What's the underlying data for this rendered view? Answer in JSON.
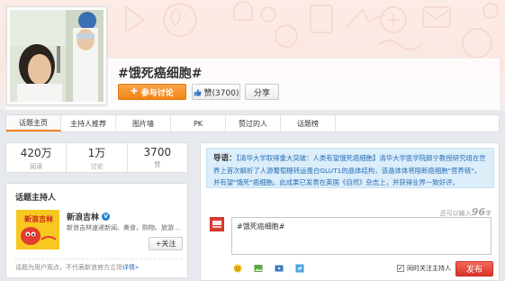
{
  "topic": {
    "title": "#饿死癌细胞#",
    "follow_label": "参与讨论",
    "like_label": "赞(3700)",
    "share_label": "分享"
  },
  "tabs": [
    {
      "label": "话题主页",
      "active": true
    },
    {
      "label": "主持人推荐"
    },
    {
      "label": "图片墙"
    },
    {
      "label": "PK"
    },
    {
      "label": "赞过的人"
    },
    {
      "label": "话题榜"
    }
  ],
  "stats": [
    {
      "value": "420万",
      "label": "阅读"
    },
    {
      "value": "1万",
      "label": "讨论"
    },
    {
      "value": "3700",
      "label": "赞"
    }
  ],
  "host": {
    "heading": "话题主持人",
    "logo_text": "新浪吉林",
    "name": "新浪吉林",
    "verified": "V",
    "desc": "新浪吉林速递新闻、美食，购物、旅游...",
    "follow_label": "+关注",
    "note": "话题为用户观点，不代表新浪官方立场",
    "note_link": "详情»"
  },
  "guide": {
    "label": "导语：",
    "text": "【清华大学取得重大突破：人类有望饿死癌细胞】清华大学医学院颜宁教授研究组在世界上首次解析了人源葡萄糖转运蛋白GLUT1的晶体结构，该晶体体将阻断癌细胞\"营养链\"，并有望\"饿死\"癌细胞。此成果已发表在英国《自然》杂志上，并获得业界一致好评。"
  },
  "composer": {
    "count_prefix": "还可以输入",
    "count_value": "96",
    "count_suffix": "字",
    "value": "#饿死癌细胞#",
    "tools": [
      "smile-icon",
      "image-icon",
      "video-icon",
      "topic-icon"
    ],
    "checkbox_label": "同时关注主持人",
    "checkbox_checked": true,
    "publish_label": "发布"
  },
  "colors": {
    "accent": "#f08416",
    "publish": "#d9322a",
    "link": "#2a6eb8",
    "guide_bg": "#dbeefa"
  }
}
